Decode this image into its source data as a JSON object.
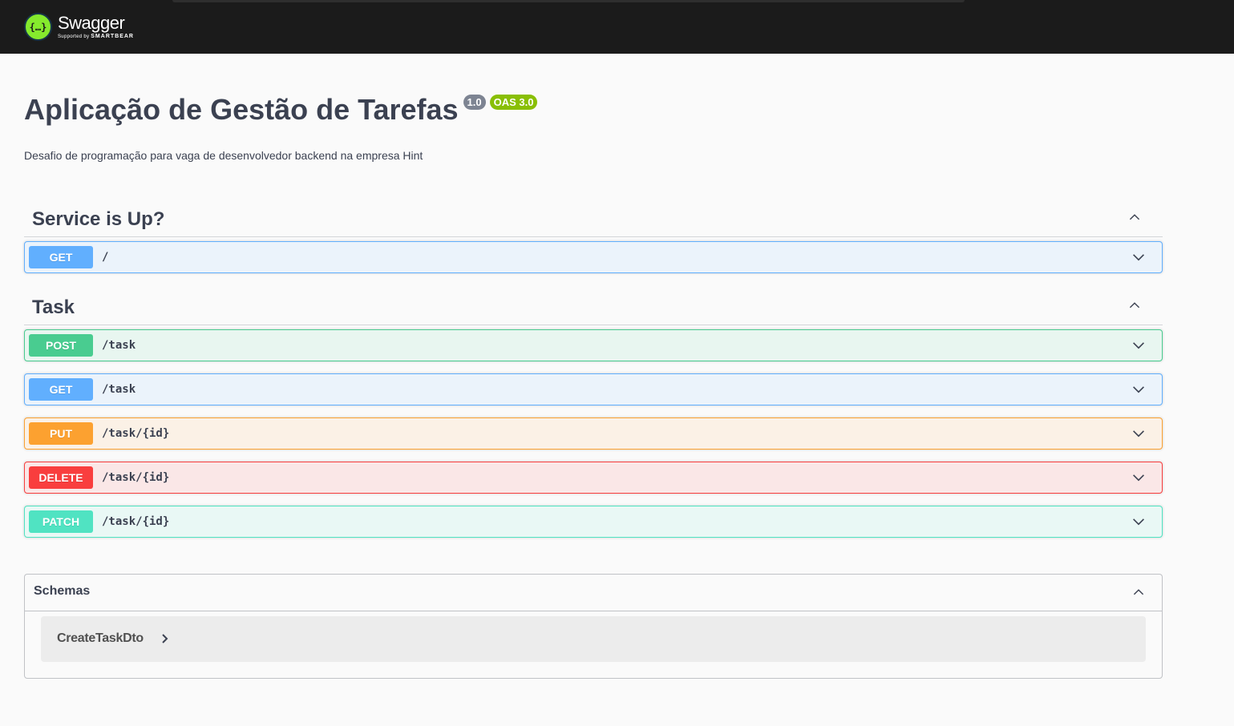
{
  "header": {
    "logo_glyph": "{…}",
    "brand": "Swagger",
    "supported_by": "Supported by",
    "company": "SMARTBEAR"
  },
  "info": {
    "title": "Aplicação de Gestão de Tarefas",
    "version": "1.0",
    "oas": "OAS 3.0",
    "description": "Desafio de programação para vaga de desenvolvedor backend na empresa Hint"
  },
  "tags": [
    {
      "name": "Service is Up?",
      "operations": [
        {
          "method": "GET",
          "path": "/"
        }
      ]
    },
    {
      "name": "Task",
      "operations": [
        {
          "method": "POST",
          "path": "/task"
        },
        {
          "method": "GET",
          "path": "/task"
        },
        {
          "method": "PUT",
          "path": "/task/{id}"
        },
        {
          "method": "DELETE",
          "path": "/task/{id}"
        },
        {
          "method": "PATCH",
          "path": "/task/{id}"
        }
      ]
    }
  ],
  "schemas": {
    "title": "Schemas",
    "models": [
      "CreateTaskDto"
    ]
  },
  "colors": {
    "get": "#61affe",
    "post": "#49cc90",
    "put": "#fca130",
    "delete": "#f93e3e",
    "patch": "#50e3c2",
    "topbar": "#1b1b1b",
    "logo": "#85ea2d"
  },
  "icons": {
    "collapse": "chevron-up-icon",
    "expand": "chevron-down-icon",
    "model": "chevron-right-icon"
  }
}
